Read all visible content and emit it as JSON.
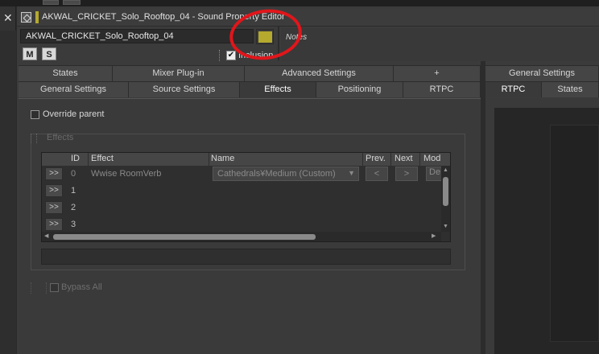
{
  "window": {
    "title": "AKWAL_CRICKET_Solo_Rooftop_04 - Sound Property Editor"
  },
  "object": {
    "name": "AKWAL_CRICKET_Solo_Rooftop_04",
    "color": "#b5a92e",
    "mute_label": "M",
    "solo_label": "S",
    "inclusion_label": "Inclusion",
    "inclusion_checked": true,
    "notes_placeholder": "Notes"
  },
  "tabs_row1": [
    {
      "label": "States"
    },
    {
      "label": "Mixer Plug-in"
    },
    {
      "label": "Advanced Settings"
    },
    {
      "label": "+"
    }
  ],
  "tabs_row2": [
    {
      "label": "General Settings"
    },
    {
      "label": "Source Settings"
    },
    {
      "label": "Effects",
      "active": true
    },
    {
      "label": "Positioning"
    },
    {
      "label": "RTPC"
    }
  ],
  "right_tabs_row1": [
    {
      "label": "General Settings"
    }
  ],
  "right_tabs_row2": [
    {
      "label": "RTPC",
      "active": true
    },
    {
      "label": "States"
    }
  ],
  "effects": {
    "override_parent_label": "Override parent",
    "override_parent_checked": false,
    "group_label": "Effects",
    "columns": [
      "ID",
      "Effect",
      "Name",
      "Prev.",
      "Next",
      "Mod"
    ],
    "rows": [
      {
        "expand": ">>",
        "id": "0",
        "effect": "Wwise RoomVerb",
        "name": "Cathedrals¥Medium (Custom)",
        "prev": "<",
        "next": ">",
        "mode": "De"
      },
      {
        "expand": ">>",
        "id": "1",
        "effect": "",
        "name": "",
        "prev": "",
        "next": "",
        "mode": ""
      },
      {
        "expand": ">>",
        "id": "2",
        "effect": "",
        "name": "",
        "prev": "",
        "next": "",
        "mode": ""
      },
      {
        "expand": ">>",
        "id": "3",
        "effect": "",
        "name": "",
        "prev": "",
        "next": "",
        "mode": ""
      }
    ],
    "bypass_all_label": "Bypass All",
    "bypass_all_checked": false
  },
  "colors": {
    "accent_marker": "#b5a92e",
    "annotation_circle": "#e0161b"
  }
}
